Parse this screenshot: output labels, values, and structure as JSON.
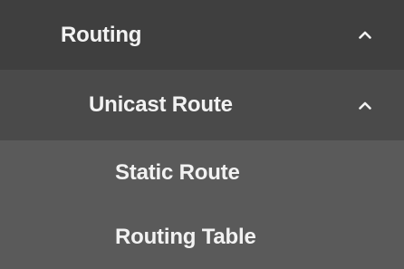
{
  "menu": {
    "routing": {
      "label": "Routing",
      "icon": "chevron-up-icon",
      "expanded": true
    },
    "unicast_route": {
      "label": "Unicast Route",
      "icon": "chevron-up-icon",
      "expanded": true
    },
    "items": [
      {
        "label": "Static Route"
      },
      {
        "label": "Routing Table"
      }
    ]
  },
  "colors": {
    "level1_bg": "#3f3f3f",
    "level2_bg": "#4a4a4a",
    "level3_bg": "#5a5a5a",
    "text": "#f2f2f2"
  }
}
